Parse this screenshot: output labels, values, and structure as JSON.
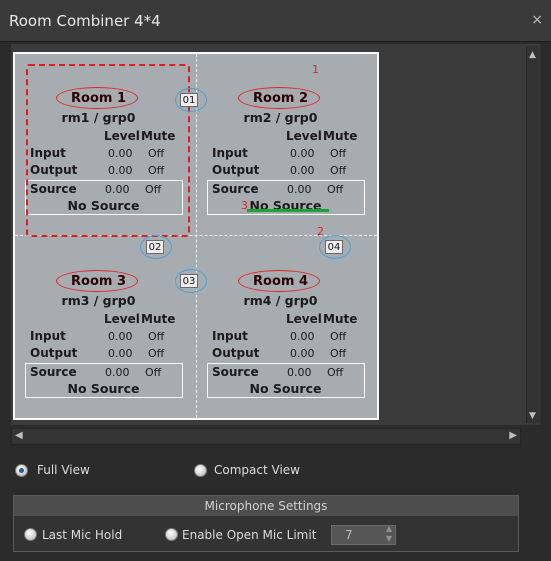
{
  "window": {
    "title": "Room Combiner 4*4",
    "close_label": "×"
  },
  "table_headers": {
    "level": "Level",
    "mute": "Mute"
  },
  "row_labels": {
    "input": "Input",
    "output": "Output",
    "source": "Source"
  },
  "rooms": [
    {
      "name": "Room 1",
      "group": "rm1 / grp0",
      "input": {
        "level": "0.00",
        "mute": "Off"
      },
      "output": {
        "level": "0.00",
        "mute": "Off"
      },
      "source": {
        "level": "0.00",
        "mute": "Off",
        "value": "No Source"
      }
    },
    {
      "name": "Room 2",
      "group": "rm2 / grp0",
      "input": {
        "level": "0.00",
        "mute": "Off"
      },
      "output": {
        "level": "0.00",
        "mute": "Off"
      },
      "source": {
        "level": "0.00",
        "mute": "Off",
        "value": "No Source"
      }
    },
    {
      "name": "Room 3",
      "group": "rm3 / grp0",
      "input": {
        "level": "0.00",
        "mute": "Off"
      },
      "output": {
        "level": "0.00",
        "mute": "Off"
      },
      "source": {
        "level": "0.00",
        "mute": "Off",
        "value": "No Source"
      }
    },
    {
      "name": "Room 4",
      "group": "rm4 / grp0",
      "input": {
        "level": "0.00",
        "mute": "Off"
      },
      "output": {
        "level": "0.00",
        "mute": "Off"
      },
      "source": {
        "level": "0.00",
        "mute": "Off",
        "value": "No Source"
      }
    }
  ],
  "wall_badges": [
    "01",
    "02",
    "03",
    "04"
  ],
  "annotations": [
    "1",
    "2",
    "3"
  ],
  "view_options": {
    "full_view": "Full View",
    "compact_view": "Compact View",
    "selected": "Full View"
  },
  "microphone_settings": {
    "header": "Microphone Settings",
    "last_mic_hold": "Last Mic Hold",
    "enable_open_mic_limit": "Enable Open Mic Limit",
    "open_mic_limit_value": "7"
  },
  "colors": {
    "selection_outline": "#e01e1e",
    "badge_ring": "#4aa3d8",
    "source_underline": "#19a43a",
    "canvas_bg": "#a7acb0"
  },
  "icons": {
    "close": "close-icon",
    "scroll_up": "arrow-up-icon",
    "scroll_down": "arrow-down-icon",
    "scroll_left": "arrow-left-icon",
    "scroll_right": "arrow-right-icon"
  }
}
